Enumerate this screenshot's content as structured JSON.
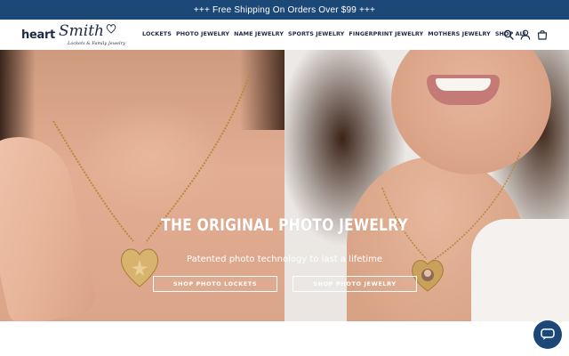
{
  "announcement": {
    "text": "+++ Free Shipping On Orders Over $99 +++"
  },
  "logo": {
    "word1": "heart",
    "word2": "Smith",
    "tagline": "Lockets & Family Jewelry"
  },
  "nav": {
    "items": [
      {
        "label": "LOCKETS"
      },
      {
        "label": "PHOTO JEWELRY"
      },
      {
        "label": "NAME JEWELRY"
      },
      {
        "label": "SPORTS JEWELRY"
      },
      {
        "label": "FINGERPRINT JEWELRY"
      },
      {
        "label": "MOTHERS JEWELRY"
      },
      {
        "label": "SHOP ALL"
      }
    ]
  },
  "header_icons": [
    "search-icon",
    "account-icon",
    "cart-icon"
  ],
  "hero": {
    "title": "THE ORIGINAL PHOTO JEWELRY",
    "subtitle": "Patented photo technology to last a lifetime",
    "button_left": "SHOP PHOTO LOCKETS",
    "button_right": "SHOP PHOTO JEWELRY"
  },
  "chat": {
    "icon": "chat-icon"
  },
  "colors": {
    "brand_navy": "#1c4878",
    "logo_navy": "#1d2a44",
    "gold": "#c9a15a"
  }
}
